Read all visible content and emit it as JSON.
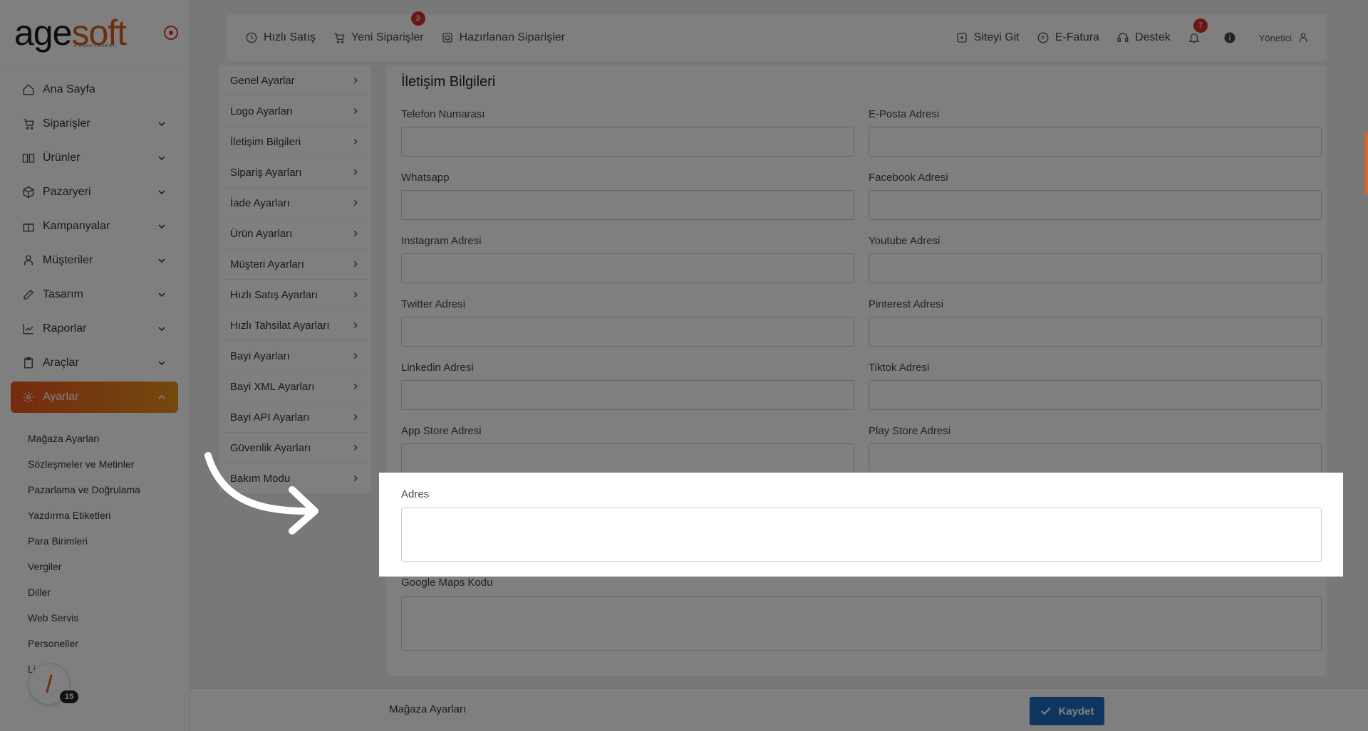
{
  "brand": {
    "logo_main": "age",
    "logo_accent": "soft",
    "logo_sub": "e-ticaret sistemleri"
  },
  "sidebar": {
    "items": [
      {
        "label": "Ana Sayfa",
        "icon": "home-icon",
        "expandable": false
      },
      {
        "label": "Siparişler",
        "icon": "cart-icon",
        "expandable": true
      },
      {
        "label": "Ürünler",
        "icon": "book-icon",
        "expandable": true
      },
      {
        "label": "Pazaryeri",
        "icon": "box-icon",
        "expandable": true
      },
      {
        "label": "Kampanyalar",
        "icon": "gift-icon",
        "expandable": true
      },
      {
        "label": "Müşteriler",
        "icon": "user-icon",
        "expandable": true
      },
      {
        "label": "Tasarım",
        "icon": "edit-icon",
        "expandable": true
      },
      {
        "label": "Raporlar",
        "icon": "chart-icon",
        "expandable": true
      },
      {
        "label": "Araçlar",
        "icon": "clipboard-icon",
        "expandable": true
      },
      {
        "label": "Ayarlar",
        "icon": "gear-icon",
        "expandable": true,
        "active": true
      }
    ],
    "subitems": [
      "Mağaza Ayarları",
      "Sözleşmeler ve Metinler",
      "Pazarlama ve Doğrulama",
      "Yazdırma Etiketleri",
      "Para Birimleri",
      "Vergiler",
      "Diller",
      "Web Servis",
      "Personeller",
      "Li"
    ],
    "help_badge": "15"
  },
  "topbar": {
    "quick_sale": "Hızlı Satış",
    "new_orders": "Yeni Siparişler",
    "new_orders_badge": "3",
    "prepared_orders": "Hazırlanan Siparişler",
    "go_site": "Siteyi Git",
    "e_invoice": "E-Fatura",
    "support": "Destek",
    "notifications_badge": "7",
    "user": "Yönetici"
  },
  "settings_menu": [
    "Genel Ayarlar",
    "Logo Ayarları",
    "İletişim Bilgileri",
    "Sipariş Ayarları",
    "İade Ayarları",
    "Ürün Ayarları",
    "Müşteri Ayarları",
    "Hızlı Satış Ayarları",
    "Hızlı Tahsilat Ayarları",
    "Bayi Ayarları",
    "Bayi XML Ayarları",
    "Bayi API Ayarları",
    "Güvenlik Ayarları",
    "Bakım Modu"
  ],
  "form": {
    "title": "İletişim Bilgileri",
    "fields": {
      "phone": {
        "label": "Telefon Numarası",
        "value": ""
      },
      "email": {
        "label": "E-Posta Adresi",
        "value": ""
      },
      "whatsapp": {
        "label": "Whatsapp",
        "value": ""
      },
      "facebook": {
        "label": "Facebook Adresi",
        "value": ""
      },
      "instagram": {
        "label": "Instagram Adresi",
        "value": ""
      },
      "youtube": {
        "label": "Youtube Adresi",
        "value": ""
      },
      "twitter": {
        "label": "Twitter Adresi",
        "value": ""
      },
      "pinterest": {
        "label": "Pinterest Adresi",
        "value": ""
      },
      "linkedin": {
        "label": "Linkedin Adresi",
        "value": ""
      },
      "tiktok": {
        "label": "Tiktok Adresi",
        "value": ""
      },
      "appstore": {
        "label": "App Store Adresi",
        "value": ""
      },
      "playstore": {
        "label": "Play Store Adresi",
        "value": ""
      },
      "address": {
        "label": "Adres",
        "value": ""
      },
      "maps": {
        "label": "Google Maps Kodu",
        "value": ""
      }
    }
  },
  "bottombar": {
    "title": "Mağaza Ayarları",
    "save_label": "Kaydet"
  }
}
